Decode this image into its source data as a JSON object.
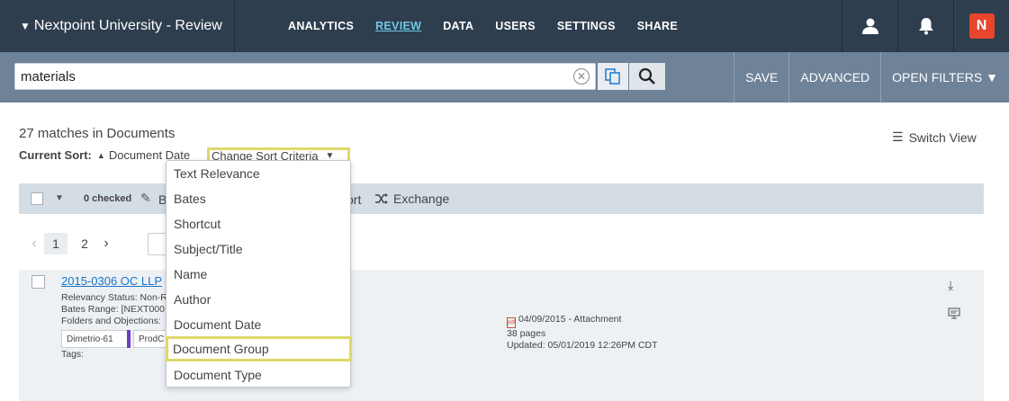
{
  "header": {
    "title": "Nextpoint University - Review",
    "title_triangle": "▼",
    "nav": [
      "ANALYTICS",
      "REVIEW",
      "DATA",
      "USERS",
      "SETTINGS",
      "SHARE"
    ],
    "active_nav": "REVIEW",
    "logo_letter": "N"
  },
  "search": {
    "query": "materials",
    "save_label": "SAVE",
    "advanced_label": "ADVANCED",
    "open_filters_label": "OPEN FILTERS ▼"
  },
  "results": {
    "matches_text": "27 matches in Documents",
    "current_sort_label": "Current Sort:",
    "current_sort_value": "Document Date",
    "change_sort_label": "Change Sort Criteria",
    "switch_view_label": "Switch View"
  },
  "toolbar": {
    "checked_label": "0 checked",
    "b_label": "B",
    "ort_label": "ort",
    "exchange_label": "Exchange"
  },
  "pager": {
    "pages": [
      "1",
      "2"
    ],
    "current": "1"
  },
  "document": {
    "title": "2015-0306 OC LLP",
    "relevancy": "Relevancy Status: Non-R",
    "bates": "Bates Range: [NEXT000",
    "folders": "Folders and Objections:",
    "tags": [
      "Dimetrio-61",
      "ProdC"
    ],
    "tags_label": "Tags:",
    "attachment_line": "04/09/2015 - Attachment",
    "pages_line": "38 pages",
    "updated_line": "Updated: 05/01/2019 12:26PM CDT",
    "pdf_icon": "pdf"
  },
  "sort_options": [
    "Text Relevance",
    "Bates",
    "Shortcut",
    "Subject/Title",
    "Name",
    "Author",
    "Document Date",
    "Document Group",
    "Document Type"
  ],
  "highlighted_option": "Document Group",
  "colors": {
    "topbar": "#2f3e4f",
    "searchbar": "#6e8298",
    "highlight": "#dcd96a",
    "link": "#1a73c9",
    "active_nav": "#6ec7e6"
  }
}
